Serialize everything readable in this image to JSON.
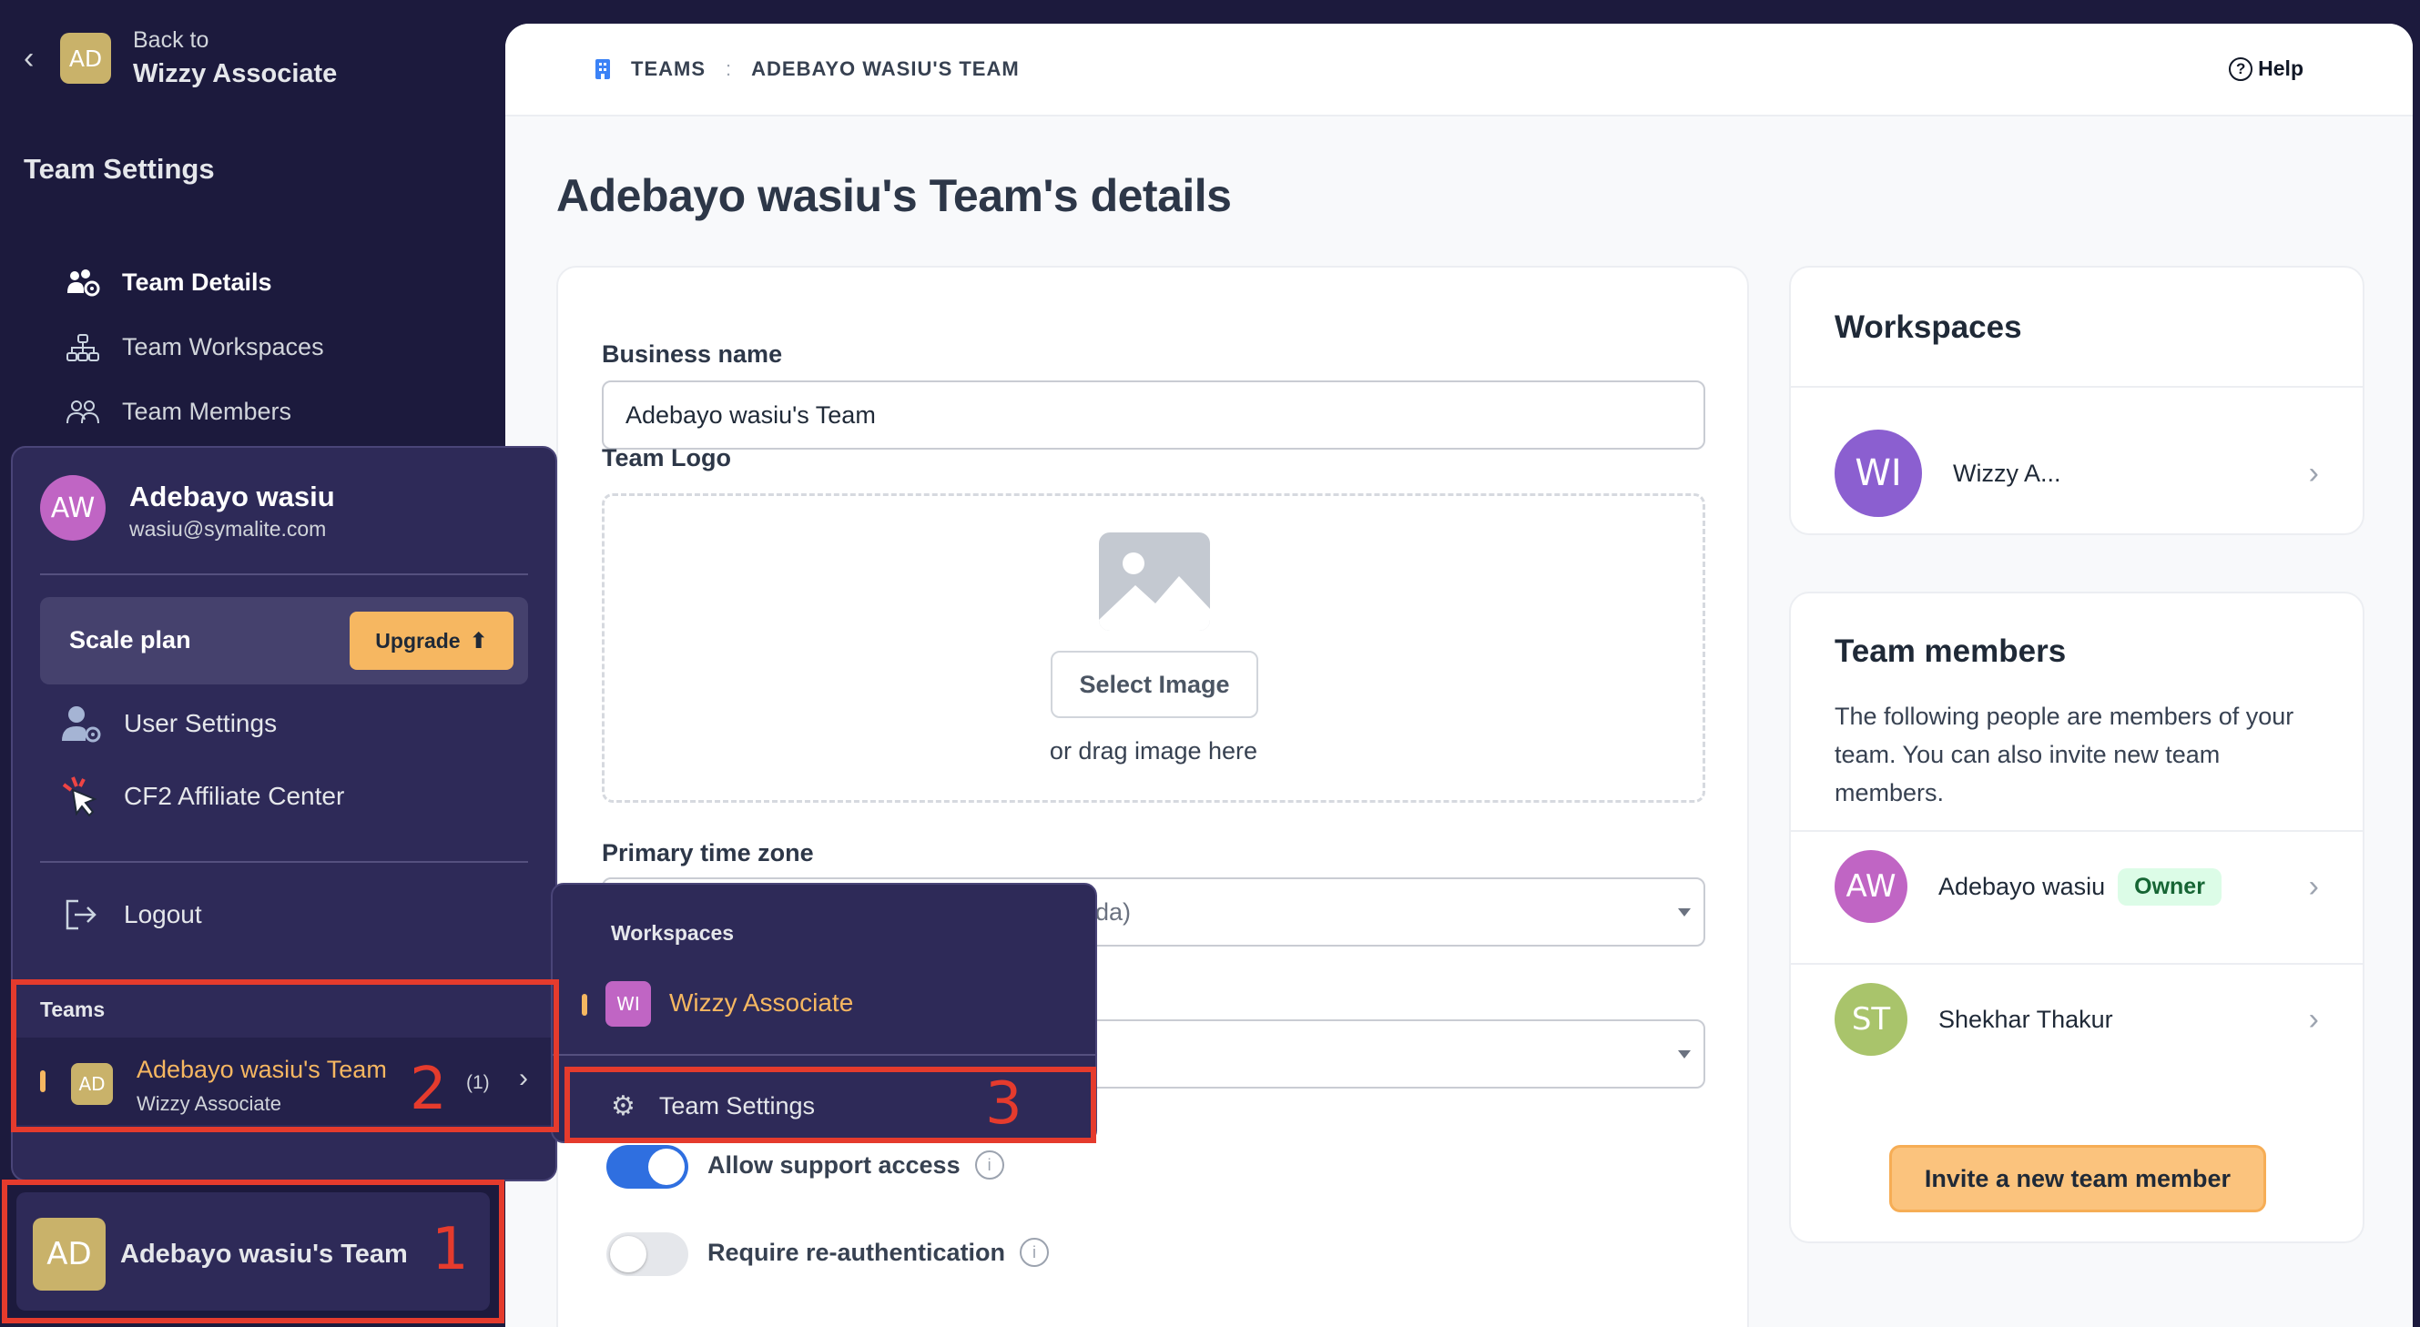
{
  "sidebar": {
    "back_label": "Back to",
    "back_target": "Wizzy Associate",
    "back_avatar": "AD",
    "title": "Team Settings",
    "items": [
      {
        "label": "Team Details",
        "icon": "team-gear-icon",
        "active": true
      },
      {
        "label": "Team Workspaces",
        "icon": "hierarchy-icon",
        "active": false
      },
      {
        "label": "Team Members",
        "icon": "people-icon",
        "active": false
      }
    ]
  },
  "breadcrumb": {
    "icon": "building-icon",
    "root": "TEAMS",
    "current": "ADEBAYO WASIU'S TEAM"
  },
  "help_label": "Help",
  "page_title": "Adebayo wasiu's Team's details",
  "form": {
    "business_name_label": "Business name",
    "business_name_value": "Adebayo wasiu's Team",
    "team_logo_label": "Team Logo",
    "select_image_label": "Select Image",
    "drag_text": "or drag image here",
    "timezone_label": "Primary time zone",
    "timezone_value_partial": "da)",
    "allow_support_label": "Allow support access",
    "allow_support_on": true,
    "require_reauth_label": "Require re-authentication",
    "require_reauth_on": false
  },
  "workspaces_card": {
    "title": "Workspaces",
    "items": [
      {
        "initials": "WI",
        "name": "Wizzy A..."
      }
    ]
  },
  "team_members_card": {
    "title": "Team members",
    "description": "The following people are members of your team. You can also invite new team members.",
    "members": [
      {
        "initials": "AW",
        "name": "Adebayo wasiu",
        "badge": "Owner"
      },
      {
        "initials": "ST",
        "name": "Shekhar Thakur",
        "badge": ""
      }
    ],
    "invite_label": "Invite a new team member"
  },
  "user_menu": {
    "initials": "AW",
    "name": "Adebayo wasiu",
    "email": "wasiu@symalite.com",
    "plan": "Scale plan",
    "upgrade_label": "Upgrade",
    "user_settings_label": "User Settings",
    "affiliate_label": "CF2 Affiliate Center",
    "logout_label": "Logout",
    "teams_label": "Teams",
    "team": {
      "initials": "AD",
      "name": "Adebayo wasiu's Team",
      "sub": "Wizzy Associate",
      "count": "(1)"
    }
  },
  "team_menu": {
    "workspaces_label": "Workspaces",
    "workspace": {
      "initials": "WI",
      "name": "Wizzy Associate"
    },
    "team_settings_label": "Team Settings"
  },
  "bottom_team": {
    "initials": "AD",
    "name": "Adebayo wasiu's Team"
  },
  "annotations": [
    "1",
    "2",
    "3"
  ],
  "colors": {
    "accent": "#f6b761",
    "sidebar_bg": "#1c1a3d",
    "annotation": "#e53b2d",
    "toggle_on": "#2f6fe0"
  }
}
